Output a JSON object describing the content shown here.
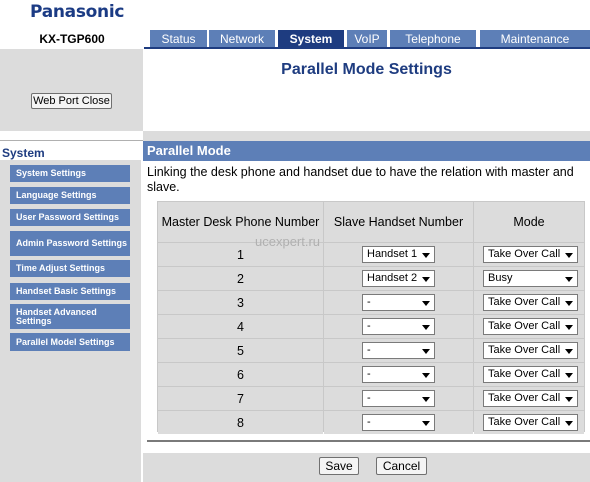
{
  "brand": "Panasonic",
  "model": "KX-TGP600",
  "tabs": [
    {
      "label": "Status"
    },
    {
      "label": "Network"
    },
    {
      "label": "System"
    },
    {
      "label": "VoIP"
    },
    {
      "label": "Telephone"
    },
    {
      "label": "Maintenance"
    }
  ],
  "active_tab": "System",
  "web_port_close_label": "Web Port Close",
  "page_title": "Parallel Mode Settings",
  "sidebar": {
    "title": "System",
    "items": [
      {
        "label": "System Settings"
      },
      {
        "label": "Language Settings"
      },
      {
        "label": "User Password Settings"
      },
      {
        "label": "Admin Password Settings"
      },
      {
        "label": "Time Adjust Settings"
      },
      {
        "label": "Handset Basic Settings"
      },
      {
        "label": "Handset Advanced Settings"
      },
      {
        "label": "Parallel Model Settings"
      }
    ]
  },
  "section": {
    "title": "Parallel Mode",
    "description": "Linking the desk phone and handset due to have the relation with master and slave."
  },
  "table": {
    "headers": [
      "Master Desk Phone Number",
      "Slave Handset Number",
      "Mode"
    ],
    "rows": [
      {
        "number": "1",
        "slave": "Handset 1",
        "mode": "Take Over Call"
      },
      {
        "number": "2",
        "slave": "Handset 2",
        "mode": "Busy"
      },
      {
        "number": "3",
        "slave": "-",
        "mode": "Take Over Call"
      },
      {
        "number": "4",
        "slave": "-",
        "mode": "Take Over Call"
      },
      {
        "number": "5",
        "slave": "-",
        "mode": "Take Over Call"
      },
      {
        "number": "6",
        "slave": "-",
        "mode": "Take Over Call"
      },
      {
        "number": "7",
        "slave": "-",
        "mode": "Take Over Call"
      },
      {
        "number": "8",
        "slave": "-",
        "mode": "Take Over Call"
      }
    ]
  },
  "buttons": {
    "save": "Save",
    "cancel": "Cancel"
  },
  "watermark": "ucexpert.ru",
  "colors": {
    "brand": "#1b3b84",
    "tab": "#5d7fb7",
    "tab_active": "#1e3c80",
    "panel": "#dcdcdc"
  }
}
